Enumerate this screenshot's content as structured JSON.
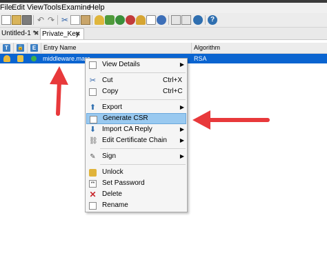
{
  "menubar": {
    "items": [
      "File",
      "Edit",
      "View",
      "Tools",
      "Examine",
      "Help"
    ]
  },
  "toolbar": {
    "icons": [
      "new-file-icon",
      "open-icon",
      "save-icon",
      "undo-icon",
      "redo-icon",
      "cut-icon",
      "copy-icon",
      "paste-icon",
      "generate-keypair-icon",
      "generate-secret-key-icon",
      "import-trusted-cert-icon",
      "import-keypair-icon",
      "set-password-icon",
      "properties-icon",
      "examine-file-icon",
      "examine-clipboard-icon",
      "examine-ssl-icon",
      "help-icon"
    ]
  },
  "tabs": [
    {
      "label": "Untitled-1 *",
      "close": "✖",
      "active": false
    },
    {
      "label": "Private_Key",
      "close": "✖",
      "active": true
    }
  ],
  "table": {
    "header_icons": [
      "T",
      "🔒",
      "E"
    ],
    "columns": [
      "Entry Name",
      "Algorithm"
    ],
    "rows": [
      {
        "entry_name": "middleware.mara",
        "algorithm": "RSA"
      }
    ]
  },
  "context_menu": {
    "items": [
      {
        "label": "View Details",
        "icon": "details-icon",
        "shortcut": "",
        "submenu": true,
        "highlighted": false
      },
      {
        "label": "Cut",
        "icon": "cut-icon",
        "shortcut": "Ctrl+X",
        "submenu": false,
        "highlighted": false
      },
      {
        "label": "Copy",
        "icon": "copy-icon",
        "shortcut": "Ctrl+C",
        "submenu": false,
        "highlighted": false
      },
      {
        "label": "Export",
        "icon": "export-icon",
        "shortcut": "",
        "submenu": true,
        "highlighted": false
      },
      {
        "label": "Generate CSR",
        "icon": "csr-icon",
        "shortcut": "",
        "submenu": false,
        "highlighted": true
      },
      {
        "label": "Import CA Reply",
        "icon": "import-icon",
        "shortcut": "",
        "submenu": true,
        "highlighted": false
      },
      {
        "label": "Edit Certificate Chain",
        "icon": "chain-icon",
        "shortcut": "",
        "submenu": true,
        "highlighted": false
      },
      {
        "label": "Sign",
        "icon": "sign-icon",
        "shortcut": "",
        "submenu": true,
        "highlighted": false
      },
      {
        "label": "Unlock",
        "icon": "unlock-icon",
        "shortcut": "",
        "submenu": false,
        "highlighted": false
      },
      {
        "label": "Set Password",
        "icon": "password-icon",
        "shortcut": "",
        "submenu": false,
        "highlighted": false
      },
      {
        "label": "Delete",
        "icon": "delete-icon",
        "shortcut": "",
        "submenu": false,
        "highlighted": false
      },
      {
        "label": "Rename",
        "icon": "rename-icon",
        "shortcut": "",
        "submenu": false,
        "highlighted": false
      }
    ]
  },
  "colors": {
    "selection": "#0a64d0",
    "menu_highlight": "#99c9f0",
    "annotation_arrow": "#e8393b"
  }
}
